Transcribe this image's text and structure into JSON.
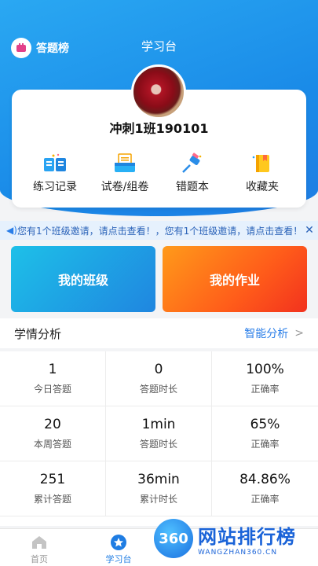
{
  "header": {
    "rank_label": "答题榜",
    "title": "学习台"
  },
  "profile": {
    "username": "冲刺1班190101"
  },
  "quick_actions": [
    {
      "label": "练习记录",
      "icon": "book-icon"
    },
    {
      "label": "试卷/组卷",
      "icon": "paper-tray-icon"
    },
    {
      "label": "错题本",
      "icon": "pin-icon"
    },
    {
      "label": "收藏夹",
      "icon": "bookmark-icon"
    }
  ],
  "notice": {
    "text": "您有1个班级邀请，请点击查看！，您有1个班级邀请，请点击查看！",
    "close": "✕"
  },
  "main_buttons": {
    "my_class": "我的班级",
    "my_homework": "我的作业"
  },
  "analysis": {
    "title": "学情分析",
    "link": "智能分析",
    "stats": [
      {
        "value": "1",
        "label": "今日答题"
      },
      {
        "value": "0",
        "label": "答题时长"
      },
      {
        "value": "100%",
        "label": "正确率"
      },
      {
        "value": "20",
        "label": "本周答题"
      },
      {
        "value": "1min",
        "label": "答题时长"
      },
      {
        "value": "65%",
        "label": "正确率"
      },
      {
        "value": "251",
        "label": "累计答题"
      },
      {
        "value": "36min",
        "label": "累计时长"
      },
      {
        "value": "84.86%",
        "label": "正确率"
      }
    ]
  },
  "tabbar": {
    "home": "首页",
    "study": "学习台"
  },
  "watermark": {
    "badge": "360",
    "title": "网站排行榜",
    "domain": "WANGZHAN360.CN"
  },
  "colors": {
    "primary": "#1f7de3",
    "orange": "#ff6a1a",
    "notice_bg": "#e6f1fd"
  }
}
